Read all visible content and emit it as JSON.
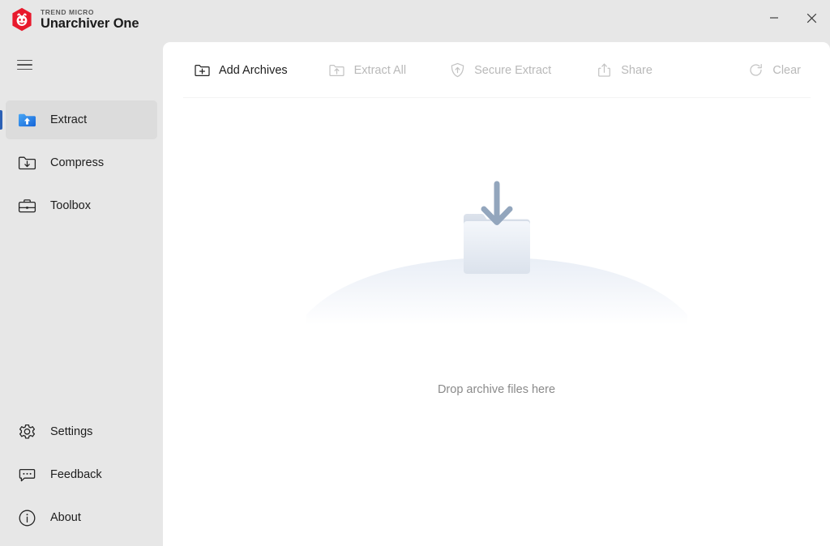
{
  "window": {
    "brand_sup": "TREND MICRO",
    "brand_name": "Unarchiver One",
    "controls": [
      {
        "name": "minimize",
        "label": "Minimize"
      },
      {
        "name": "close",
        "label": "Close"
      }
    ]
  },
  "sidebar": {
    "menu_button_label": "Menu",
    "top_items": [
      {
        "label": "Extract",
        "icon": "extract-folder-icon",
        "selected": true
      },
      {
        "label": "Compress",
        "icon": "compress-folder-icon",
        "selected": false
      },
      {
        "label": "Toolbox",
        "icon": "toolbox-icon",
        "selected": false
      }
    ],
    "bottom_items": [
      {
        "label": "Settings",
        "icon": "gear-icon"
      },
      {
        "label": "Feedback",
        "icon": "feedback-icon"
      },
      {
        "label": "About",
        "icon": "info-icon"
      }
    ]
  },
  "toolbar": {
    "items": [
      {
        "label": "Add Archives",
        "icon": "folder-plus-icon",
        "disabled": false
      },
      {
        "label": "Extract All",
        "icon": "folder-up-icon",
        "disabled": true
      },
      {
        "label": "Secure Extract",
        "icon": "shield-up-icon",
        "disabled": true
      },
      {
        "label": "Share",
        "icon": "share-icon",
        "disabled": true
      }
    ],
    "clear": {
      "label": "Clear",
      "icon": "refresh-icon",
      "disabled": true
    }
  },
  "main": {
    "drop_text": "Drop archive files here",
    "illustration": "folder-download-illustration"
  },
  "colors": {
    "accent": "#2c60b5",
    "brand_red": "#e8192c",
    "sidebar_bg": "#e7e7e7",
    "panel_bg": "#ffffff",
    "selected_bg": "#dcdcdc",
    "muted_text": "#8a8a8a",
    "disabled_text": "#b9b9b9"
  }
}
